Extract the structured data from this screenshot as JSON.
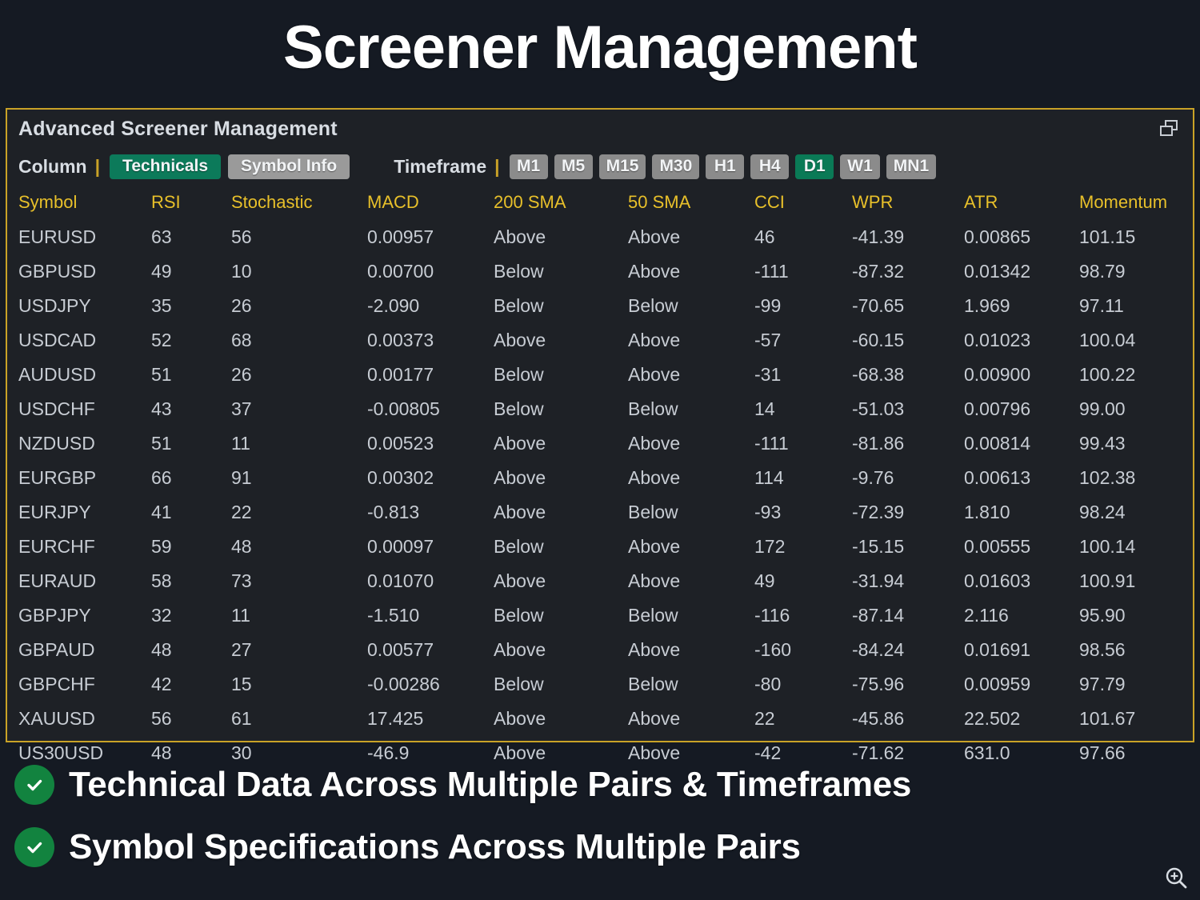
{
  "page": {
    "title": "Screener Management",
    "background_color": "#151a23"
  },
  "panel": {
    "title": "Advanced Screener Management",
    "border_color": "#c9a227",
    "restore_icon": "restore-window-icon"
  },
  "controls": {
    "column_label": "Column",
    "separator": "|",
    "column_buttons": [
      {
        "label": "Technicals",
        "active": true
      },
      {
        "label": "Symbol Info",
        "active": false
      }
    ],
    "timeframe_label": "Timeframe",
    "timeframe_buttons": [
      {
        "label": "M1",
        "active": false
      },
      {
        "label": "M5",
        "active": false
      },
      {
        "label": "M15",
        "active": false
      },
      {
        "label": "M30",
        "active": false
      },
      {
        "label": "H1",
        "active": false
      },
      {
        "label": "H4",
        "active": false
      },
      {
        "label": "D1",
        "active": true
      },
      {
        "label": "W1",
        "active": false
      },
      {
        "label": "MN1",
        "active": false
      }
    ],
    "active_color": "#0c7a5a",
    "inactive_color": "#9a9a9a"
  },
  "table": {
    "header_color": "#e8c02a",
    "columns": [
      "Symbol",
      "RSI",
      "Stochastic",
      "MACD",
      "200 SMA",
      "50 SMA",
      "CCI",
      "WPR",
      "ATR",
      "Momentum"
    ],
    "rows": [
      [
        "EURUSD",
        "63",
        "56",
        "0.00957",
        "Above",
        "Above",
        "46",
        "-41.39",
        "0.00865",
        "101.15"
      ],
      [
        "GBPUSD",
        "49",
        "10",
        "0.00700",
        "Below",
        "Above",
        "-111",
        "-87.32",
        "0.01342",
        "98.79"
      ],
      [
        "USDJPY",
        "35",
        "26",
        "-2.090",
        "Below",
        "Below",
        "-99",
        "-70.65",
        "1.969",
        "97.11"
      ],
      [
        "USDCAD",
        "52",
        "68",
        "0.00373",
        "Above",
        "Above",
        "-57",
        "-60.15",
        "0.01023",
        "100.04"
      ],
      [
        "AUDUSD",
        "51",
        "26",
        "0.00177",
        "Below",
        "Above",
        "-31",
        "-68.38",
        "0.00900",
        "100.22"
      ],
      [
        "USDCHF",
        "43",
        "37",
        "-0.00805",
        "Below",
        "Below",
        "14",
        "-51.03",
        "0.00796",
        "99.00"
      ],
      [
        "NZDUSD",
        "51",
        "11",
        "0.00523",
        "Above",
        "Above",
        "-111",
        "-81.86",
        "0.00814",
        "99.43"
      ],
      [
        "EURGBP",
        "66",
        "91",
        "0.00302",
        "Above",
        "Above",
        "114",
        "-9.76",
        "0.00613",
        "102.38"
      ],
      [
        "EURJPY",
        "41",
        "22",
        "-0.813",
        "Above",
        "Below",
        "-93",
        "-72.39",
        "1.810",
        "98.24"
      ],
      [
        "EURCHF",
        "59",
        "48",
        "0.00097",
        "Below",
        "Above",
        "172",
        "-15.15",
        "0.00555",
        "100.14"
      ],
      [
        "EURAUD",
        "58",
        "73",
        "0.01070",
        "Above",
        "Above",
        "49",
        "-31.94",
        "0.01603",
        "100.91"
      ],
      [
        "GBPJPY",
        "32",
        "11",
        "-1.510",
        "Below",
        "Below",
        "-116",
        "-87.14",
        "2.116",
        "95.90"
      ],
      [
        "GBPAUD",
        "48",
        "27",
        "0.00577",
        "Above",
        "Above",
        "-160",
        "-84.24",
        "0.01691",
        "98.56"
      ],
      [
        "GBPCHF",
        "42",
        "15",
        "-0.00286",
        "Below",
        "Below",
        "-80",
        "-75.96",
        "0.00959",
        "97.79"
      ],
      [
        "XAUUSD",
        "56",
        "61",
        "17.425",
        "Above",
        "Above",
        "22",
        "-45.86",
        "22.502",
        "101.67"
      ],
      [
        "US30USD",
        "48",
        "30",
        "-46.9",
        "Above",
        "Above",
        "-42",
        "-71.62",
        "631.0",
        "97.66"
      ]
    ]
  },
  "bullets": [
    {
      "icon": "check-circle-icon",
      "text": "Technical Data Across Multiple Pairs & Timeframes",
      "color": "#12833f"
    },
    {
      "icon": "check-circle-icon",
      "text": "Symbol Specifications Across Multiple Pairs",
      "color": "#12833f"
    }
  ],
  "corner": {
    "zoom_icon": "zoom-in-magnifier-icon"
  }
}
